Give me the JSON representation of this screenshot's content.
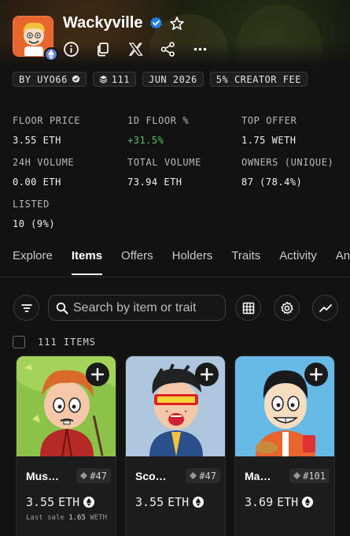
{
  "collection": {
    "name": "Wackyville"
  },
  "chips": [
    {
      "label": "BY UYO66"
    },
    {
      "label": "111"
    },
    {
      "label": "JUN 2026"
    },
    {
      "label": "5% CREATOR FEE"
    }
  ],
  "stats": [
    {
      "label": "FLOOR PRICE",
      "value": "3.55 ETH"
    },
    {
      "label": "1D FLOOR %",
      "value": "+31.5%"
    },
    {
      "label": "TOP OFFER",
      "value": "1.75 WETH"
    },
    {
      "label": "24H VOLUME",
      "value": "0.00 ETH"
    },
    {
      "label": "TOTAL VOLUME",
      "value": "73.94 ETH"
    },
    {
      "label": "OWNERS (UNIQUE)",
      "value": "87 (78.4%)"
    },
    {
      "label": "LISTED",
      "value": "10 (9%)"
    }
  ],
  "tabs": [
    {
      "label": "Explore"
    },
    {
      "label": "Items"
    },
    {
      "label": "Offers"
    },
    {
      "label": "Holders"
    },
    {
      "label": "Traits"
    },
    {
      "label": "Activity"
    },
    {
      "label": "Ana"
    }
  ],
  "search": {
    "placeholder": "Search by item or trait"
  },
  "items": {
    "count_label": "111 ITEMS"
  },
  "cards": [
    {
      "name": "Mus…",
      "number": "#47",
      "price": "3.55",
      "currency": "ETH",
      "last_sale_label": "Last sale",
      "last_sale_value": "1.65",
      "last_sale_currency": "WETH"
    },
    {
      "name": "Sco…",
      "number": "#47",
      "price": "3.55",
      "currency": "ETH"
    },
    {
      "name": "Ma…",
      "number": "#101",
      "price": "3.69",
      "currency": "ETH"
    }
  ],
  "colors": {
    "background": "#121212",
    "positive": "#58c06a",
    "verified": "#2081e2",
    "card1_bg": "#8cc24a",
    "card2_bg": "#aec7df",
    "card3_bg": "#67b9e6"
  }
}
